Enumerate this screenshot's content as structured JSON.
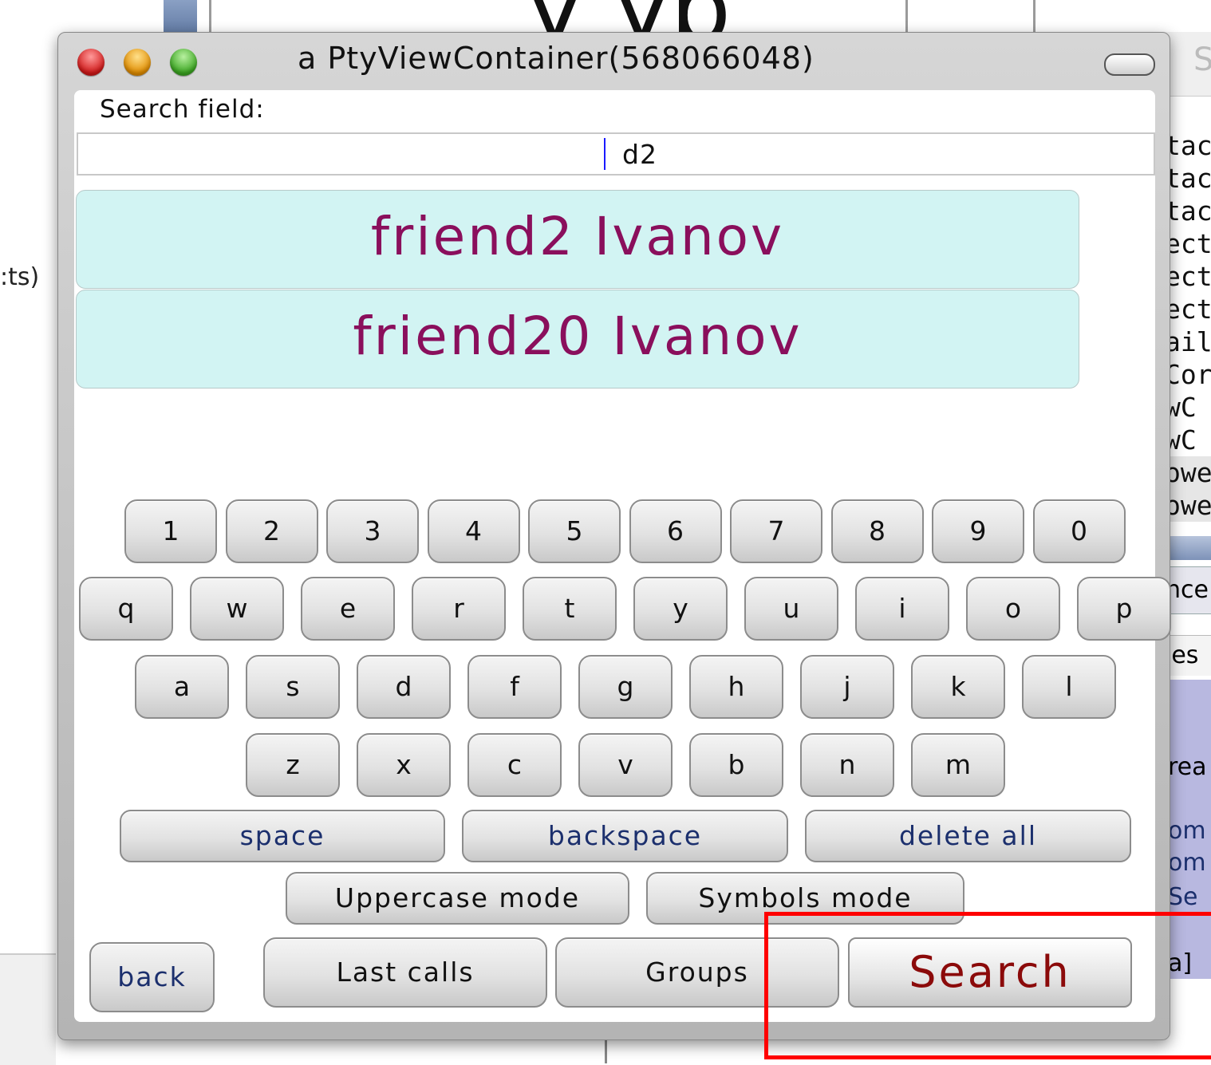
{
  "window": {
    "title": "a PtyViewContainer(568066048)"
  },
  "search": {
    "label": "Search field:",
    "value": "d2"
  },
  "results": [
    {
      "name": "friend2 Ivanov"
    },
    {
      "name": "friend20 Ivanov"
    }
  ],
  "keyboard": {
    "row_digits": [
      "1",
      "2",
      "3",
      "4",
      "5",
      "6",
      "7",
      "8",
      "9",
      "0"
    ],
    "row_q": [
      "q",
      "w",
      "e",
      "r",
      "t",
      "y",
      "u",
      "i",
      "o",
      "p"
    ],
    "row_a": [
      "a",
      "s",
      "d",
      "f",
      "g",
      "h",
      "j",
      "k",
      "l"
    ],
    "row_z": [
      "z",
      "x",
      "c",
      "v",
      "b",
      "n",
      "m"
    ],
    "space": "space",
    "backspace": "backspace",
    "delete_all": "delete all",
    "uppercase_mode": "Uppercase mode",
    "symbols_mode": "Symbols mode"
  },
  "nav": {
    "back": "back",
    "last_calls": "Last calls",
    "groups": "Groups",
    "search": "Search"
  },
  "background": {
    "top_text": "y yp",
    "left_text": ":ts)",
    "right_header": "S",
    "right_lines": [
      "tac",
      "tac",
      "tac",
      "ect",
      "ect",
      "ect",
      "aile",
      "Cor",
      "wC",
      "wC",
      "owe",
      "owe"
    ],
    "right_tab1": "nce",
    "right_tab2": "les",
    "right_blue": [
      "rea",
      "om",
      "om",
      "Se",
      "a]"
    ]
  }
}
